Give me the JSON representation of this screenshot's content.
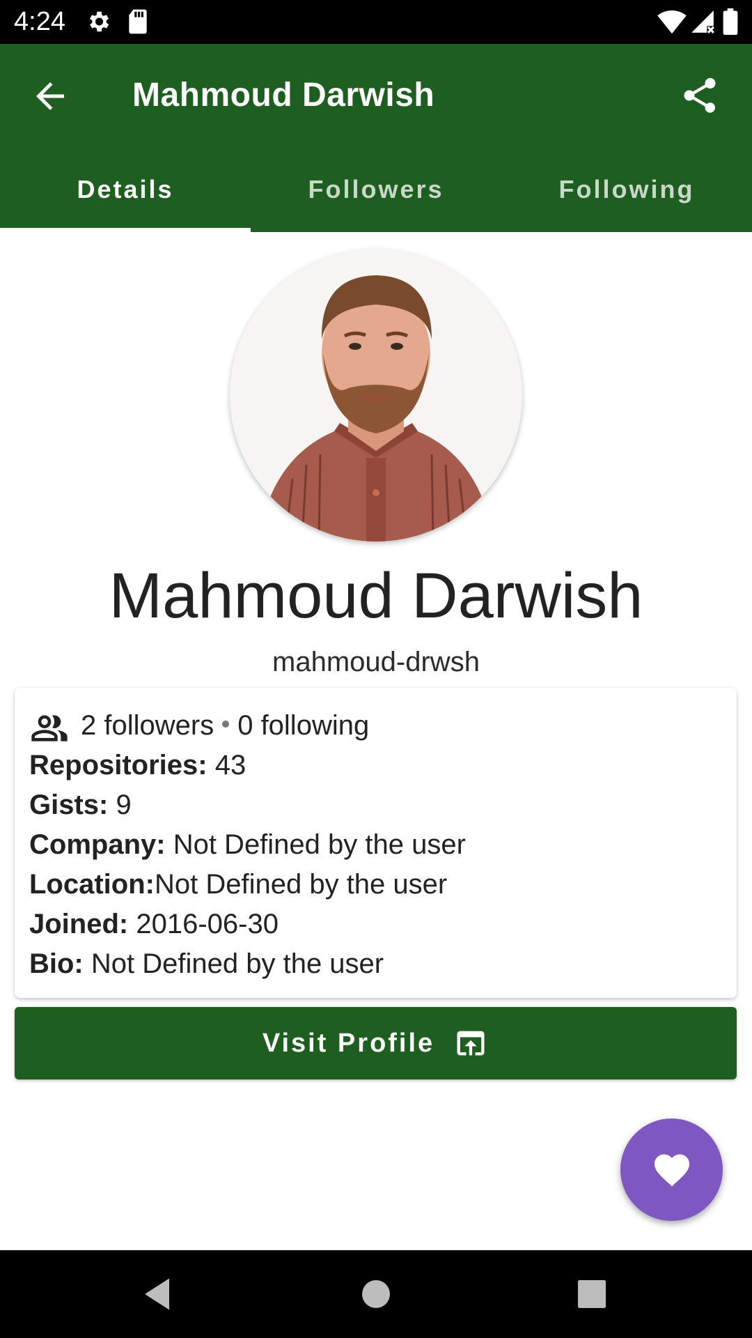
{
  "status_bar": {
    "time": "4:24",
    "icons": [
      "settings-icon",
      "sd-card-icon",
      "wifi-icon",
      "signal-icon",
      "battery-icon"
    ]
  },
  "app_bar": {
    "title": "Mahmoud Darwish",
    "back_icon": "arrow-left-icon",
    "share_icon": "share-icon"
  },
  "tabs": [
    {
      "label": "Details",
      "active": true
    },
    {
      "label": "Followers",
      "active": false
    },
    {
      "label": "Following",
      "active": false
    }
  ],
  "profile": {
    "display_name": "Mahmoud Darwish",
    "username": "mahmoud-drwsh"
  },
  "stats": {
    "followers": "2 followers",
    "following": "0 following",
    "repositories_label": "Repositories:",
    "repositories_value": " 43",
    "gists_label": "Gists:",
    "gists_value": " 9",
    "company_label": "Company:",
    "company_value": " Not Defined by the user",
    "location_label": "Location:",
    "location_value": "Not Defined by the user",
    "joined_label": "Joined:",
    "joined_value": " 2016-06-30",
    "bio_label": "Bio:",
    "bio_value": " Not Defined by the user"
  },
  "visit_button": {
    "label": "Visit Profile",
    "icon": "open-in-browser-icon"
  },
  "fab": {
    "icon": "heart-icon"
  },
  "nav_bar": {
    "icons": [
      "back-triangle-icon",
      "home-circle-icon",
      "recents-square-icon"
    ]
  },
  "colors": {
    "primary": "#1e5e20",
    "fab": "#7e57c2",
    "text": "#222222"
  }
}
